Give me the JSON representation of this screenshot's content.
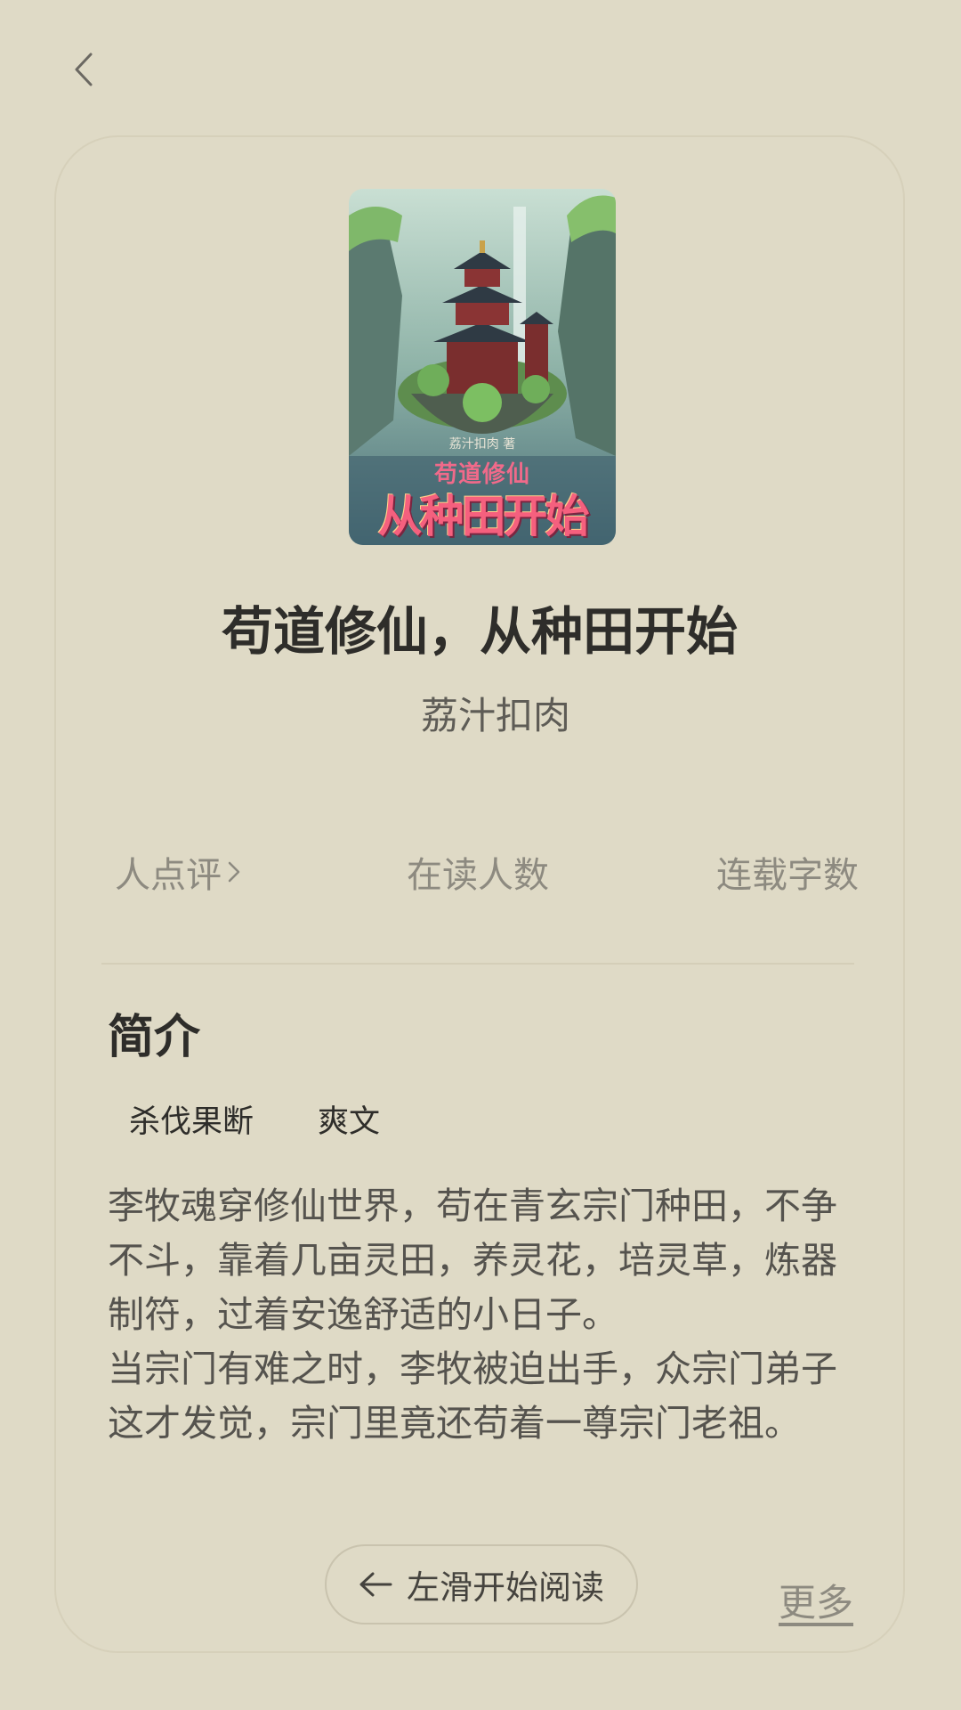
{
  "nav": {
    "back_icon": "chevron-left-icon"
  },
  "book": {
    "cover": {
      "author_line": "荔汁扣肉 著",
      "subtitle": "苟道修仙",
      "main_title": "从种田开始"
    },
    "title": "苟道修仙，从种田开始",
    "author": "荔汁扣肉"
  },
  "stats": {
    "reviews_label": "人点评",
    "readers_label": "在读人数",
    "words_label": "连载字数"
  },
  "intro": {
    "heading": "简介",
    "tags": [
      "杀伐果断",
      "爽文"
    ],
    "synopsis": "李牧魂穿修仙世界，苟在青玄宗门种田，不争\n不斗，靠着几亩灵田，养灵花，培灵草，炼器\n制符，过着安逸舒适的小日子。\n当宗门有难之时，李牧被迫出手，众宗门弟子\n这才发觉，宗门里竟还苟着一尊宗门老祖。"
  },
  "actions": {
    "read_label": "左滑开始阅读",
    "more_label": "更多"
  },
  "colors": {
    "background": "#dfdac6",
    "title_text": "#2e2d2a",
    "muted_text": "#8d8a80"
  }
}
